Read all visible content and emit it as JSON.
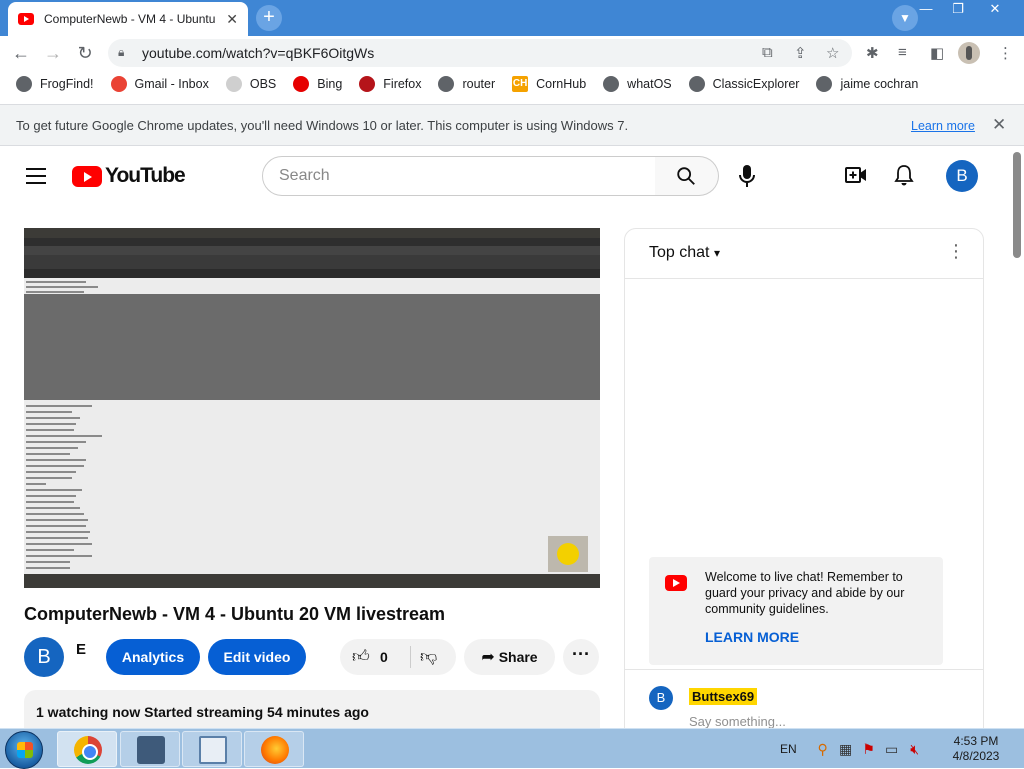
{
  "browser": {
    "tab_title": "ComputerNewb - VM 4 - Ubuntu",
    "tab_close": "✕",
    "new_tab": "+",
    "url": "youtube.com/watch?v=qBKF6OitgWs",
    "bookmarks": [
      {
        "label": "FrogFind!",
        "icon": "globe-icon",
        "color": "#5f6368"
      },
      {
        "label": "Gmail - Inbox",
        "icon": "gmail-icon",
        "color": "#ea4335"
      },
      {
        "label": "OBS",
        "icon": "obs-icon",
        "color": "#cfcfcf"
      },
      {
        "label": "Bing",
        "icon": "sky-icon",
        "color": "#e60000"
      },
      {
        "label": "Firefox",
        "icon": "firefox-icon",
        "color": "#b5141a"
      },
      {
        "label": "router",
        "icon": "globe-icon",
        "color": "#5f6368"
      },
      {
        "label": "CornHub",
        "icon": "ch-icon",
        "color": "#f5a200"
      },
      {
        "label": "whatOS",
        "icon": "globe-icon",
        "color": "#5f6368"
      },
      {
        "label": "ClassicExplorer",
        "icon": "globe-icon",
        "color": "#5f6368"
      },
      {
        "label": "jaime cochran",
        "icon": "globe-icon",
        "color": "#5f6368"
      }
    ],
    "infobar_message": "To get future Google Chrome updates, you'll need Windows 10 or later. This computer is using Windows 7.",
    "infobar_link": "Learn more"
  },
  "youtube": {
    "logo_text": "YouTube",
    "search_placeholder": "Search",
    "avatar_letter": "B",
    "video_title": "ComputerNewb - VM 4 - Ubuntu 20 VM livestream",
    "channel_initial": "B",
    "channel_name": "E",
    "analytics_label": "Analytics",
    "edit_label": "Edit video",
    "like_count": "0",
    "share_label": "Share",
    "description_meta": "1 watching now  Started streaming 54 minutes ago"
  },
  "chat": {
    "title": "Top chat",
    "welcome_text": "Welcome to live chat! Remember to guard your privacy and abide by our community guidelines.",
    "learn_more": "LEARN MORE",
    "user_initial": "B",
    "username": "Buttsex69",
    "input_placeholder": "Say something..."
  },
  "taskbar": {
    "language": "EN",
    "time": "4:53 PM",
    "date": "4/8/2023"
  }
}
